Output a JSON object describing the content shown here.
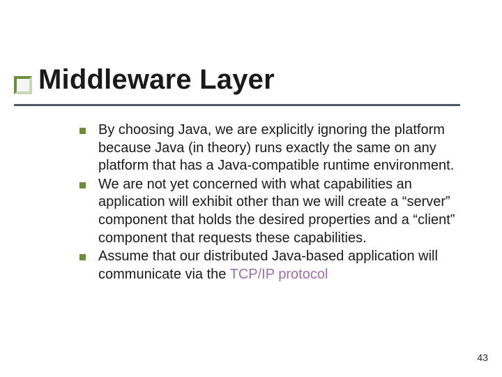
{
  "title": "Middleware Layer",
  "bullets": [
    {
      "text_pre": "By choosing Java, we are explicitly ignoring the platform because Java (in theory) runs exactly the same on any platform that has a Java-compatible runtime environment.",
      "text_link": "",
      "text_post": ""
    },
    {
      "text_pre": "We are not yet concerned with what capabilities an application will exhibit other than we will create a “server” component that holds the desired properties and a “client” component that requests these capabilities.",
      "text_link": "",
      "text_post": ""
    },
    {
      "text_pre": "Assume that our distributed Java-based application will communicate via the ",
      "text_link": "TCP/IP protocol",
      "text_post": ""
    }
  ],
  "page_number": "43",
  "colors": {
    "accent": "#6b8e3d",
    "link": "#9b6fae",
    "underline": "#4b5a66"
  }
}
